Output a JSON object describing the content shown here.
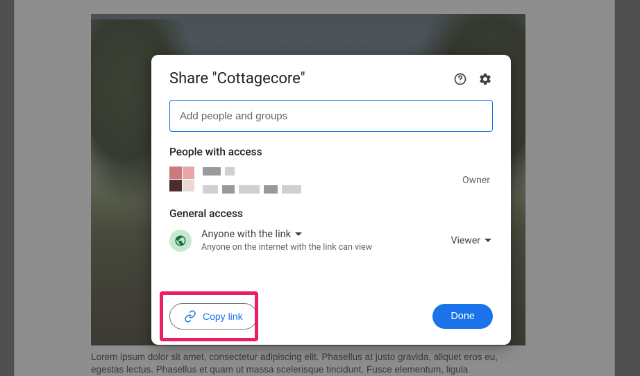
{
  "dialog": {
    "title": "Share \"Cottagecore\"",
    "input_placeholder": "Add people and groups",
    "sections": {
      "people_heading": "People with access",
      "general_heading": "General access"
    },
    "owner_role": "Owner",
    "general_access": {
      "type_label": "Anyone with the link",
      "description": "Anyone on the internet with the link can view",
      "role": "Viewer"
    },
    "buttons": {
      "copy_link": "Copy link",
      "done": "Done"
    }
  },
  "page_text": "Lorem ipsum dolor sit amet, consectetur adipiscing elit. Phasellus at justo gravida, aliquet eros eu, egestas lectus. Phasellus et quam ut massa scelerisque tincidunt. Fusce elementum, ligula"
}
